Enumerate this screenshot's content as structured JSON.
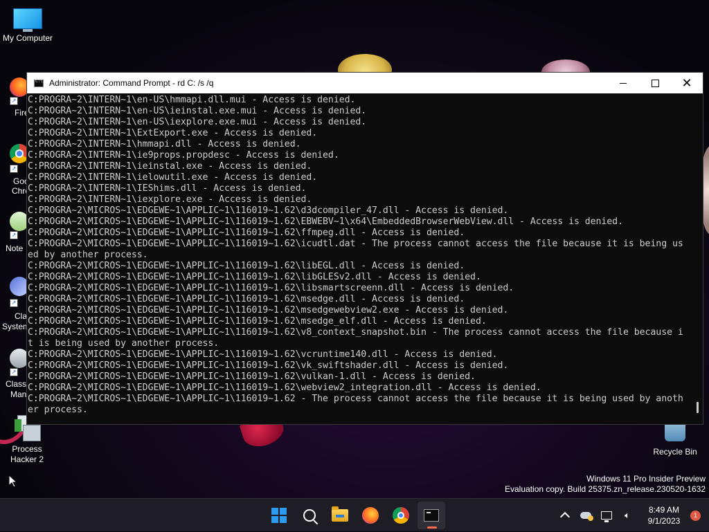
{
  "desktop": {
    "icons": {
      "my_computer": "My Computer",
      "process_hacker": "Process\nHacker 2",
      "recycle_bin": "Recycle Bin"
    },
    "partial_labels": {
      "firefox": "Fire",
      "chrome_1": "Goo",
      "chrome_2": "Chro",
      "notepad": "Note",
      "classic_sys_1": "Cla",
      "classic_sys_2": "System",
      "classic_mgr_1": "Classi",
      "classic_mgr_2": "Man"
    },
    "watermark": {
      "line1": "Windows 11 Pro Insider Preview",
      "line2": "Evaluation copy. Build 25375.zn_release.230520-1632"
    }
  },
  "window": {
    "title": "Administrator:  Command Prompt - rd  C: /s /q",
    "buttons": {
      "minimize": "",
      "maximize": "",
      "close": "✕"
    },
    "console_lines": [
      "C:PROGRA~2\\INTERN~1\\en-US\\hmmapi.dll.mui - Access is denied.",
      "C:PROGRA~2\\INTERN~1\\en-US\\ieinstal.exe.mui - Access is denied.",
      "C:PROGRA~2\\INTERN~1\\en-US\\iexplore.exe.mui - Access is denied.",
      "C:PROGRA~2\\INTERN~1\\ExtExport.exe - Access is denied.",
      "C:PROGRA~2\\INTERN~1\\hmmapi.dll - Access is denied.",
      "C:PROGRA~2\\INTERN~1\\ie9props.propdesc - Access is denied.",
      "C:PROGRA~2\\INTERN~1\\ieinstal.exe - Access is denied.",
      "C:PROGRA~2\\INTERN~1\\ielowutil.exe - Access is denied.",
      "C:PROGRA~2\\INTERN~1\\IEShims.dll - Access is denied.",
      "C:PROGRA~2\\INTERN~1\\iexplore.exe - Access is denied.",
      "C:PROGRA~2\\MICROS~1\\EDGEWE~1\\APPLIC~1\\116019~1.62\\d3dcompiler_47.dll - Access is denied.",
      "C:PROGRA~2\\MICROS~1\\EDGEWE~1\\APPLIC~1\\116019~1.62\\EBWEBV~1\\x64\\EmbeddedBrowserWebView.dll - Access is denied.",
      "C:PROGRA~2\\MICROS~1\\EDGEWE~1\\APPLIC~1\\116019~1.62\\ffmpeg.dll - Access is denied.",
      "C:PROGRA~2\\MICROS~1\\EDGEWE~1\\APPLIC~1\\116019~1.62\\icudtl.dat - The process cannot access the file because it is being us",
      "ed by another process.",
      "C:PROGRA~2\\MICROS~1\\EDGEWE~1\\APPLIC~1\\116019~1.62\\libEGL.dll - Access is denied.",
      "C:PROGRA~2\\MICROS~1\\EDGEWE~1\\APPLIC~1\\116019~1.62\\libGLESv2.dll - Access is denied.",
      "C:PROGRA~2\\MICROS~1\\EDGEWE~1\\APPLIC~1\\116019~1.62\\libsmartscreenn.dll - Access is denied.",
      "C:PROGRA~2\\MICROS~1\\EDGEWE~1\\APPLIC~1\\116019~1.62\\msedge.dll - Access is denied.",
      "C:PROGRA~2\\MICROS~1\\EDGEWE~1\\APPLIC~1\\116019~1.62\\msedgewebview2.exe - Access is denied.",
      "C:PROGRA~2\\MICROS~1\\EDGEWE~1\\APPLIC~1\\116019~1.62\\msedge_elf.dll - Access is denied.",
      "C:PROGRA~2\\MICROS~1\\EDGEWE~1\\APPLIC~1\\116019~1.62\\v8_context_snapshot.bin - The process cannot access the file because i",
      "t is being used by another process.",
      "C:PROGRA~2\\MICROS~1\\EDGEWE~1\\APPLIC~1\\116019~1.62\\vcruntime140.dll - Access is denied.",
      "C:PROGRA~2\\MICROS~1\\EDGEWE~1\\APPLIC~1\\116019~1.62\\vk_swiftshader.dll - Access is denied.",
      "C:PROGRA~2\\MICROS~1\\EDGEWE~1\\APPLIC~1\\116019~1.62\\vulkan-1.dll - Access is denied.",
      "C:PROGRA~2\\MICROS~1\\EDGEWE~1\\APPLIC~1\\116019~1.62\\webview2_integration.dll - Access is denied.",
      "C:PROGRA~2\\MICROS~1\\EDGEWE~1\\APPLIC~1\\116019~1.62 - The process cannot access the file because it is being used by anoth",
      "er process."
    ]
  },
  "taskbar": {
    "apps": [
      {
        "icon": "windows-start-icon"
      },
      {
        "icon": "search-icon"
      },
      {
        "icon": "file-explorer-icon"
      },
      {
        "icon": "firefox-icon"
      },
      {
        "icon": "chrome-icon"
      },
      {
        "icon": "terminal-icon",
        "active": true
      }
    ],
    "tray": {
      "time": "8:49 AM",
      "date": "9/1/2023",
      "notification_count": "1"
    }
  },
  "colors": {
    "console_bg": "#0c0c0c",
    "console_fg": "#cccccc",
    "taskbar_bg": "#1e1c24",
    "accent_windows": "#2d9bf0",
    "notification_badge": "#e25a43"
  }
}
